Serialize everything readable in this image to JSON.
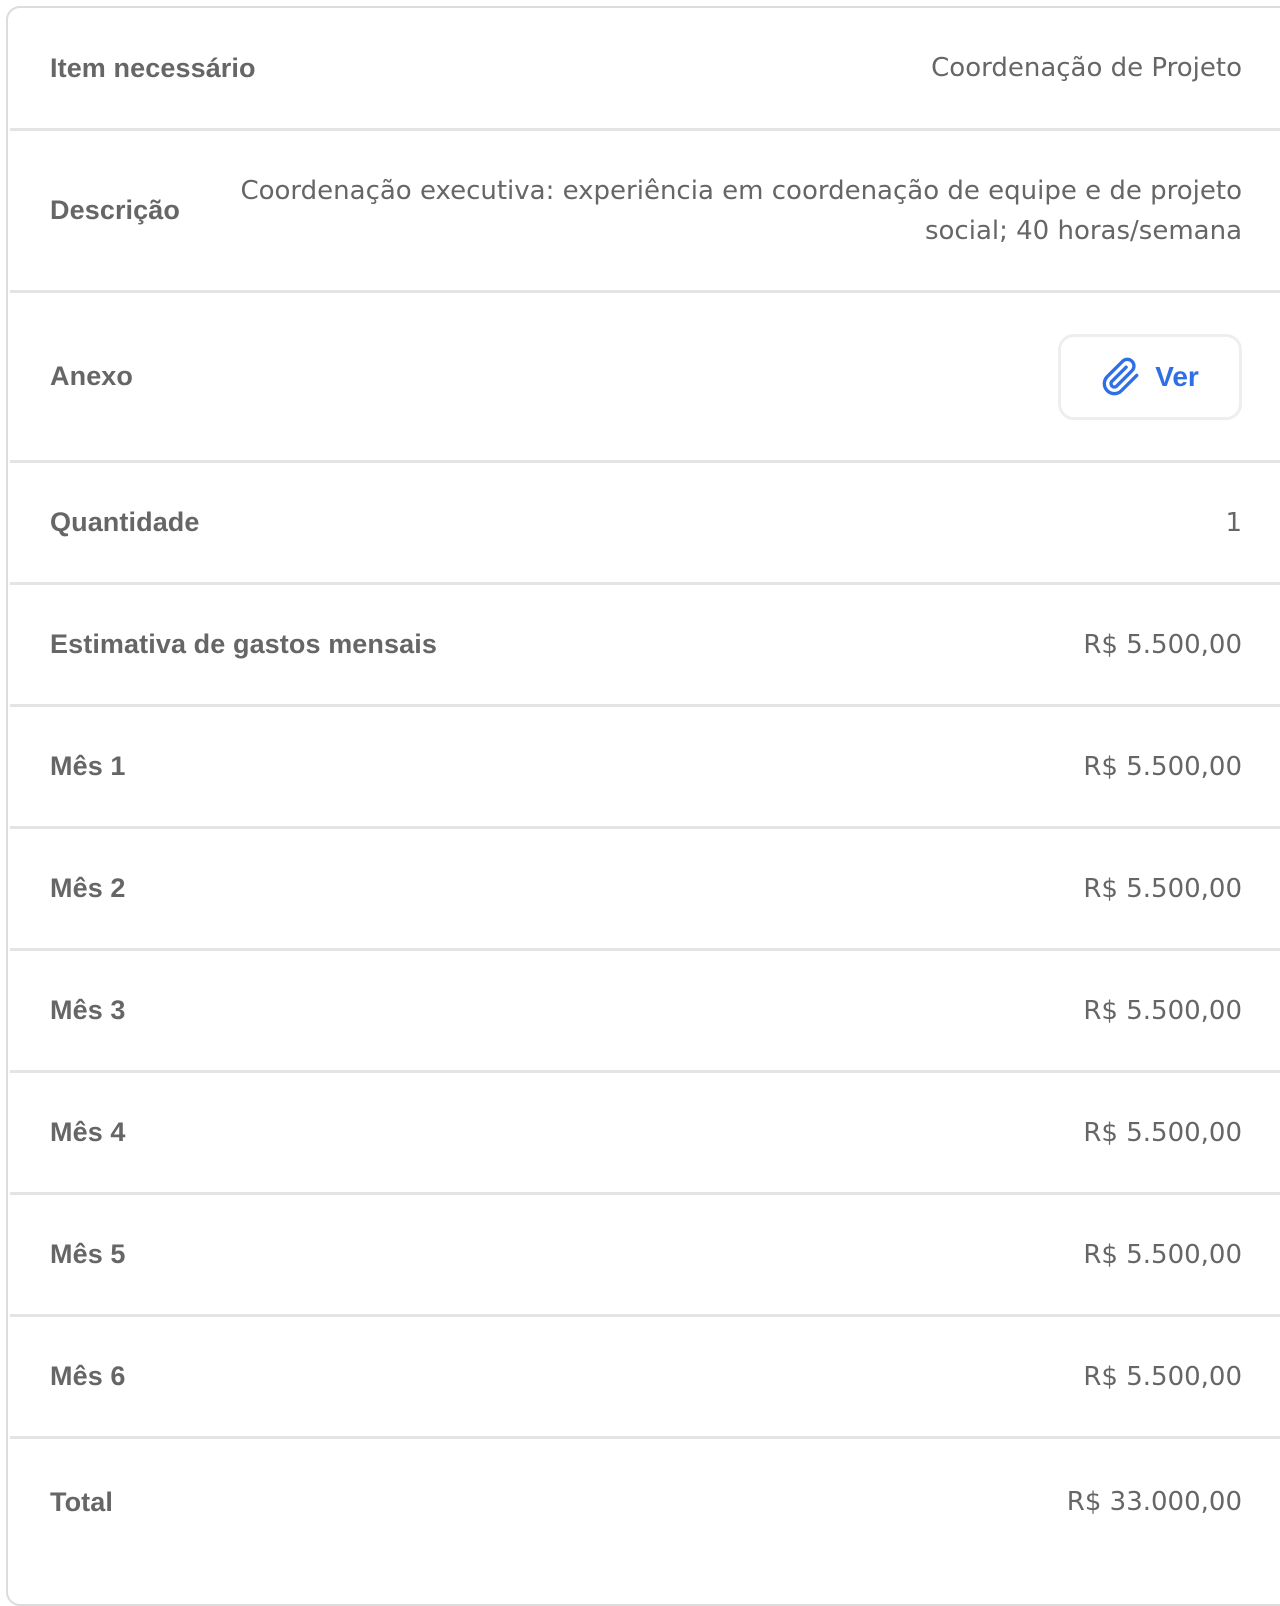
{
  "item": {
    "label": "Item necessário",
    "value": "Coordenação de Projeto"
  },
  "description": {
    "label": "Descrição",
    "value": "Coordenação executiva: experiência em coordenação de equipe e de projeto social; 40 horas/semana"
  },
  "attachment": {
    "label": "Anexo",
    "button_label": "Ver",
    "icon": "paperclip-icon",
    "accent_color": "#2f6fe6"
  },
  "quantity": {
    "label": "Quantidade",
    "value": "1"
  },
  "monthly_estimate": {
    "label": "Estimativa de gastos mensais",
    "value": "R$ 5.500,00"
  },
  "months": [
    {
      "label": "Mês 1",
      "value": "R$ 5.500,00"
    },
    {
      "label": "Mês 2",
      "value": "R$ 5.500,00"
    },
    {
      "label": "Mês 3",
      "value": "R$ 5.500,00"
    },
    {
      "label": "Mês 4",
      "value": "R$ 5.500,00"
    },
    {
      "label": "Mês 5",
      "value": "R$ 5.500,00"
    },
    {
      "label": "Mês 6",
      "value": "R$ 5.500,00"
    }
  ],
  "total": {
    "label": "Total",
    "value": "R$ 33.000,00"
  }
}
